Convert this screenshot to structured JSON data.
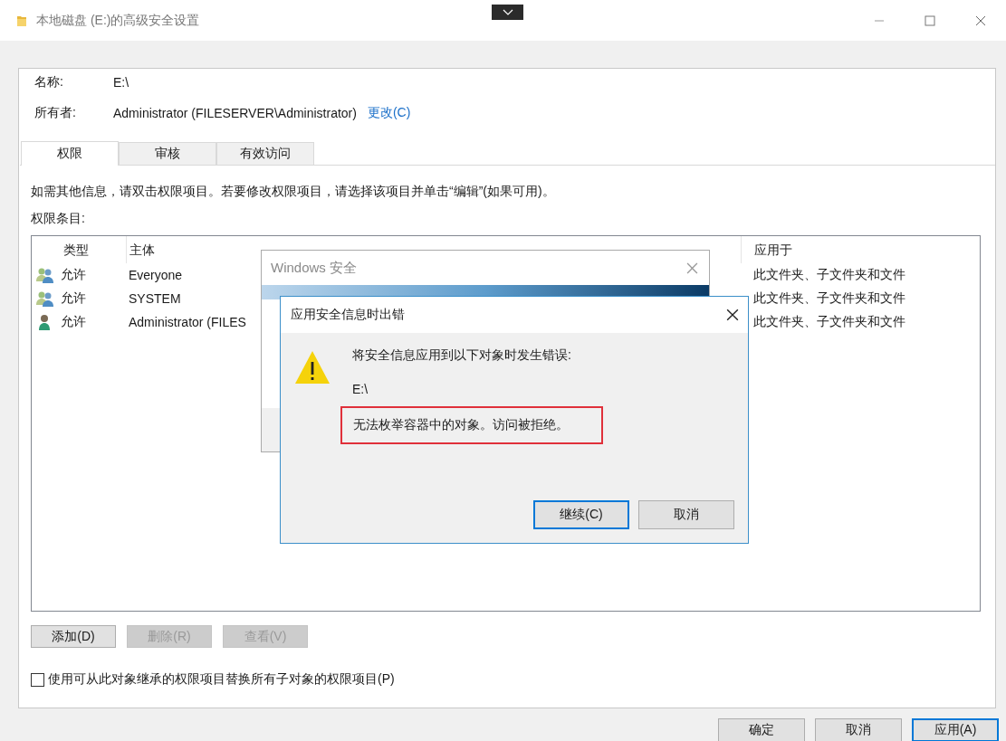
{
  "window": {
    "title": "本地磁盘 (E:)的高级安全设置"
  },
  "name": {
    "label": "名称:",
    "value": "E:\\"
  },
  "owner": {
    "label": "所有者:",
    "value": "Administrator (FILESERVER\\Administrator)",
    "link": "更改(C)"
  },
  "tabs": [
    {
      "label": "权限",
      "selected": true
    },
    {
      "label": "审核",
      "selected": false
    },
    {
      "label": "有效访问",
      "selected": false
    }
  ],
  "info": "如需其他信息，请双击权限项目。若要修改权限项目，请选择该项目并单击“编辑”(如果可用)。",
  "entries_label": "权限条目:",
  "table": {
    "columns": [
      "类型",
      "主体",
      "应用于"
    ],
    "rows": [
      {
        "kind": "group",
        "type": "允许",
        "principal": "Everyone",
        "applies_to": "此文件夹、子文件夹和文件"
      },
      {
        "kind": "group",
        "type": "允许",
        "principal": "SYSTEM",
        "applies_to": "此文件夹、子文件夹和文件"
      },
      {
        "kind": "user",
        "type": "允许",
        "principal": "Administrator (FILES",
        "applies_to": "此文件夹、子文件夹和文件"
      }
    ]
  },
  "entry_buttons": [
    {
      "label": "添加(D)",
      "disabled": false
    },
    {
      "label": "删除(R)",
      "disabled": true
    },
    {
      "label": "查看(V)",
      "disabled": true
    }
  ],
  "replace_checkbox": {
    "label": "使用可从此对象继承的权限项目替换所有子对象的权限项目(P)",
    "checked": false
  },
  "footer_buttons": [
    {
      "label": "确定",
      "default": false
    },
    {
      "label": "取消",
      "default": false
    },
    {
      "label": "应用(A)",
      "default": true
    }
  ],
  "security_dialog": {
    "title": "Windows 安全"
  },
  "error_dialog": {
    "title": "应用安全信息时出错",
    "message": "将安全信息应用到以下对象时发生错误:",
    "path": "E:\\",
    "error": "无法枚举容器中的对象。访问被拒绝。",
    "error_highlighted": true,
    "buttons": [
      {
        "label": "继续(C)",
        "default": true
      },
      {
        "label": "取消",
        "default": false
      }
    ]
  }
}
